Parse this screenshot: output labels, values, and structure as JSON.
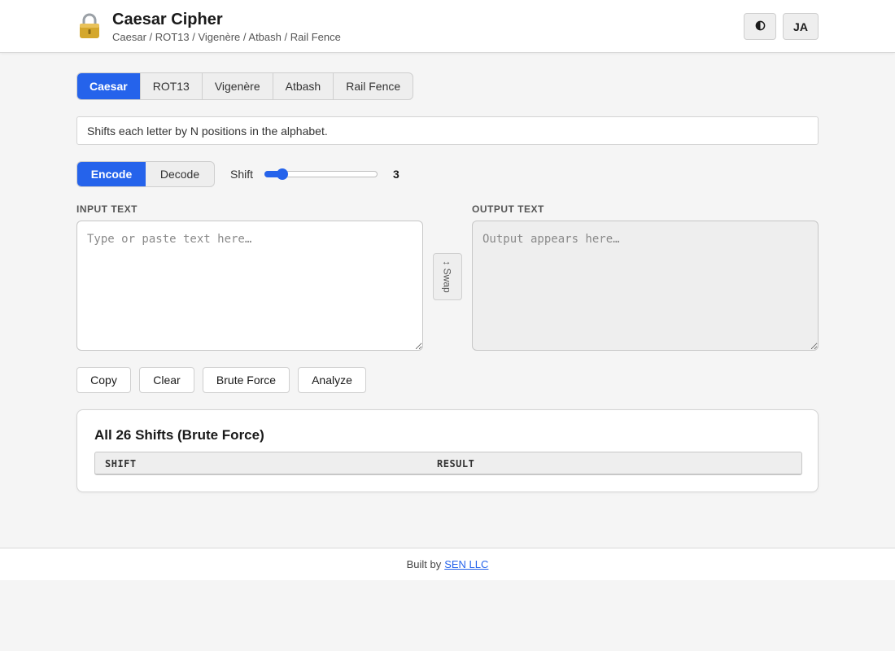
{
  "header": {
    "title": "Caesar Cipher",
    "subtitle": "Caesar / ROT13 / Vigenère / Atbash / Rail Fence",
    "theme_icon": "half-circle-contrast-icon",
    "lang_label": "JA"
  },
  "tabs": [
    {
      "label": "Caesar",
      "active": true
    },
    {
      "label": "ROT13",
      "active": false
    },
    {
      "label": "Vigenère",
      "active": false
    },
    {
      "label": "Atbash",
      "active": false
    },
    {
      "label": "Rail Fence",
      "active": false
    }
  ],
  "description": "Shifts each letter by N positions in the alphabet.",
  "mode": {
    "encode_label": "Encode",
    "decode_label": "Decode",
    "selected": "encode"
  },
  "shift": {
    "label": "Shift",
    "value": "3",
    "min": 0,
    "max": 25
  },
  "input": {
    "label": "INPUT TEXT",
    "placeholder": "Type or paste text here…",
    "value": ""
  },
  "output": {
    "label": "OUTPUT TEXT",
    "placeholder": "Output appears here…",
    "value": ""
  },
  "swap_label": "↕ Swap",
  "actions": {
    "copy": "Copy",
    "clear": "Clear",
    "brute_force": "Brute Force",
    "analyze": "Analyze"
  },
  "brute_force_panel": {
    "title": "All 26 Shifts (Brute Force)",
    "columns": [
      "SHIFT",
      "RESULT"
    ],
    "rows": []
  },
  "footer": {
    "text": "Built by",
    "link_text": "SEN LLC"
  },
  "colors": {
    "accent": "#2563eb",
    "background": "#f5f5f5",
    "panel": "#ffffff"
  }
}
